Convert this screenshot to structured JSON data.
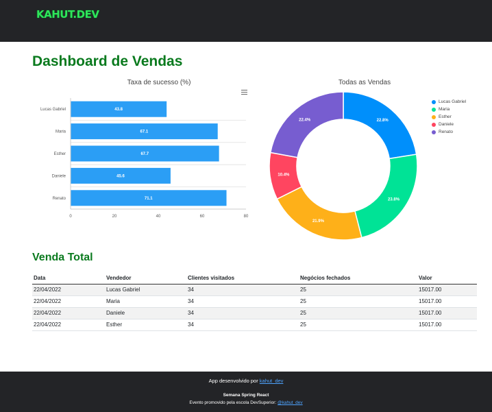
{
  "header": {
    "logo_text": "KAHUT.DEV"
  },
  "page_title": "Dashboard de Vendas",
  "bar_chart": {
    "title": "Taxa de sucesso (%)"
  },
  "donut_chart": {
    "title": "Todas as Vendas"
  },
  "chart_data": [
    {
      "type": "bar",
      "orientation": "horizontal",
      "title": "Taxa de sucesso (%)",
      "categories": [
        "Lucas Gabriel",
        "Maria",
        "Esther",
        "Daniele",
        "Renato"
      ],
      "values": [
        43.8,
        67.1,
        67.7,
        45.6,
        71.1
      ],
      "xlim": [
        0,
        80
      ],
      "xticks": [
        0,
        20,
        40,
        60,
        80
      ],
      "color": "#2b9ef5"
    },
    {
      "type": "pie",
      "donut": true,
      "title": "Todas as Vendas",
      "labels": [
        "Lucas Gabriel",
        "Maria",
        "Esther",
        "Daniele",
        "Renato"
      ],
      "values": [
        22.8,
        23.8,
        21.9,
        10.4,
        22.4
      ],
      "value_labels": [
        "22.8%",
        "23.8%",
        "21.9%",
        "10.4%",
        "22.4%"
      ],
      "colors": [
        "#008ffb",
        "#00e396",
        "#feb019",
        "#ff4560",
        "#775dd0"
      ],
      "legend_position": "right"
    }
  ],
  "sales_section": {
    "title": "Venda Total",
    "columns": [
      "Data",
      "Vendedor",
      "Clientes visitados",
      "Negócios fechados",
      "Valor"
    ],
    "rows": [
      [
        "22/04/2022",
        "Lucas Gabriel",
        "34",
        "25",
        "15017.00"
      ],
      [
        "22/04/2022",
        "Maria",
        "34",
        "25",
        "15017.00"
      ],
      [
        "22/04/2022",
        "Daniele",
        "34",
        "25",
        "15017.00"
      ],
      [
        "22/04/2022",
        "Esther",
        "34",
        "25",
        "15017.00"
      ]
    ]
  },
  "footer": {
    "line1_prefix": "App desenvolvido por ",
    "line1_link": "kahut_dev",
    "line2": "Semana Spring React",
    "line3_prefix": "Evento promovido pela escola DevSuperior: ",
    "line3_link": "@kahut_dev"
  }
}
